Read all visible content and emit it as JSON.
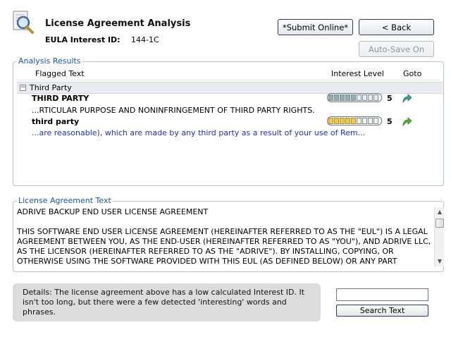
{
  "header": {
    "title": "License Agreement Analysis",
    "eula_label": "EULA Interest ID:",
    "eula_value": "144-1C"
  },
  "buttons": {
    "submit_online": "*Submit Online*",
    "back": "< Back",
    "auto_save": "Auto-Save On",
    "search_text": "Search Text"
  },
  "results": {
    "section_title": "Analysis Results",
    "columns": [
      "Flagged Text",
      "Interest Level",
      "Goto"
    ],
    "group": {
      "label": "Third Party",
      "expander": "−"
    },
    "items": [
      {
        "term": "THIRD PARTY",
        "snippet": "...RTICULAR PURPOSE AND NONINFRINGEMENT OF THIRD PARTY RIGHTS.",
        "score": "5",
        "level": 0.5,
        "meter_color": "#8fb0ad",
        "goto_icon": "goto-arrow-teal"
      },
      {
        "term": "third party",
        "snippet": "...are reasonable), which are made by any third party as a result of your use of Rem...",
        "score": "5",
        "level": 0.5,
        "meter_color": "#f2c84b",
        "goto_icon": "goto-arrow-green"
      }
    ]
  },
  "license": {
    "section_title": "License Agreement Text",
    "text": "ADRIVE BACKUP END USER LICENSE AGREEMENT\n\nTHIS SOFTWARE END USER LICENSE AGREEMENT (HEREINAFTER REFERRED TO AS THE \"EUL\") IS A LEGAL AGREEMENT BETWEEN YOU, AS THE END-USER (HEREINAFTER REFERRED TO AS \"YOU\"), AND ADRIVE LLC, AS THE LICENSOR (HEREINAFTER REFERRED TO AS THE \"ADRIVE\"). BY INSTALLING, COPYING, OR OTHERWISE USING THE SOFTWARE PROVIDED WITH THIS EUL (AS DEFINED BELOW) OR ANY PART"
  },
  "details": {
    "text": "Details: The license agreement above has a low calculated Interest ID. It isn't too long, but there were a few detected 'interesting' words and phrases."
  },
  "search": {
    "value": "",
    "placeholder": ""
  },
  "colors": {
    "accent_blue": "#1a55b0",
    "snippet_blue": "#1b2fcc",
    "group_border": "#b8c1cc"
  }
}
